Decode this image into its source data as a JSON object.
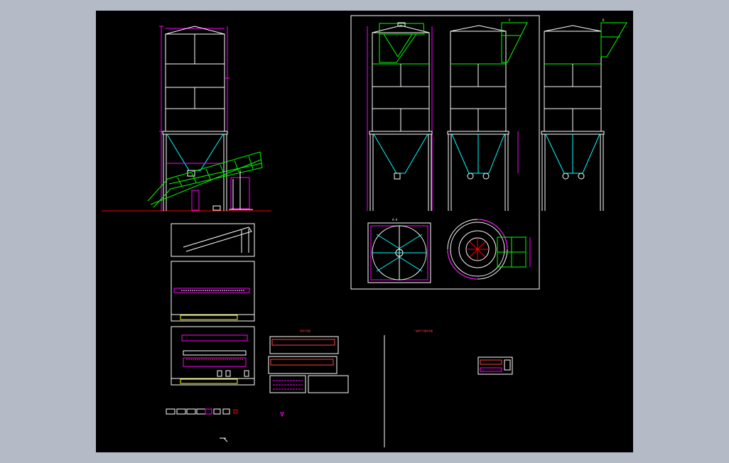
{
  "viewport": {
    "background": "#b4bac6",
    "canvas_background": "#000000"
  },
  "colors": {
    "outline": "#ffffff",
    "dimension": "#ff00ff",
    "hopper": "#00ffff",
    "conveyor": "#00ff00",
    "ground": "#ff0000",
    "centerline": "#ff0000"
  },
  "labels": {
    "section_a": "A-A",
    "section_b": "B-B",
    "detail_c": "C",
    "detail_d": "D",
    "plan_view": "A-A",
    "electric_plan_title": "一般电气平面布置图",
    "cabinet_title": "柜体示意图"
  }
}
